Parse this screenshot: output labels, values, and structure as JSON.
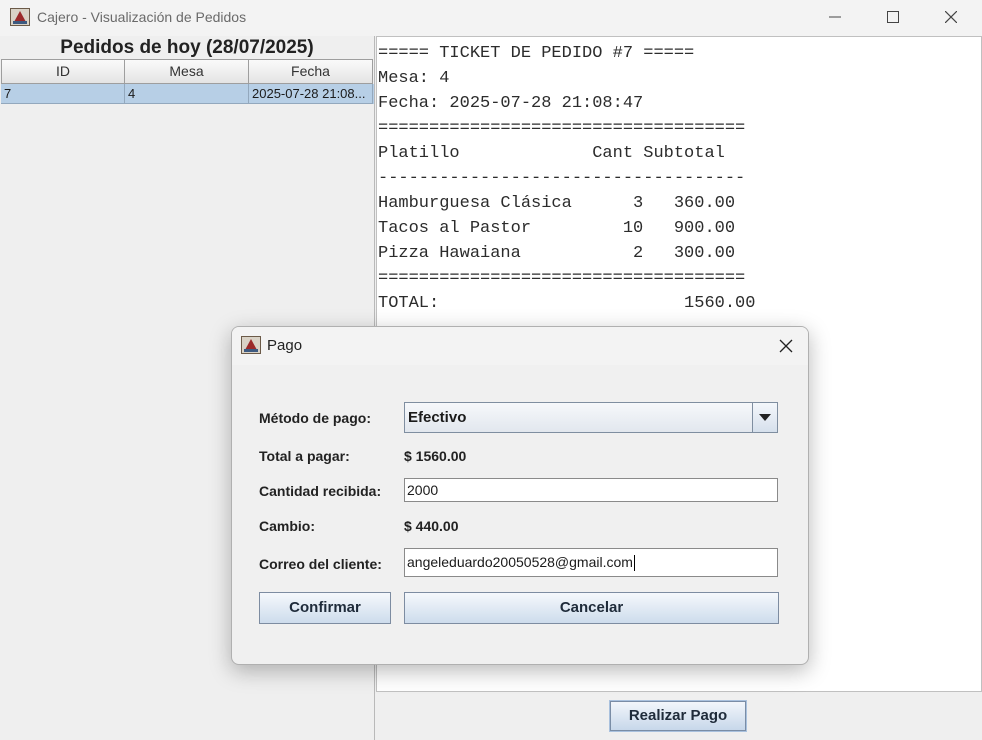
{
  "window": {
    "title": "Cajero - Visualización de Pedidos"
  },
  "orders": {
    "heading": "Pedidos de hoy (28/07/2025)",
    "columns": [
      "ID",
      "Mesa",
      "Fecha"
    ],
    "rows": [
      {
        "id": "7",
        "mesa": "4",
        "fecha": "2025-07-28 21:08..."
      }
    ]
  },
  "ticket": {
    "lines": [
      "===== TICKET DE PEDIDO #7 =====",
      "Mesa: 4",
      "Fecha: 2025-07-28 21:08:47",
      "====================================",
      "Platillo             Cant Subtotal",
      "------------------------------------",
      "Hamburguesa Clásica      3   360.00",
      "Tacos al Pastor         10   900.00",
      "Pizza Hawaiana           2   300.00",
      "====================================",
      "TOTAL:                        1560.00"
    ]
  },
  "footer": {
    "pay_button": "Realizar Pago"
  },
  "dialog": {
    "title": "Pago",
    "payment_method_label": "Método de pago:",
    "payment_method_value": "Efectivo",
    "total_label": "Total a pagar:",
    "total_value": "$ 1560.00",
    "received_label": "Cantidad recibida:",
    "received_value": "2000",
    "change_label": "Cambio:",
    "change_value": "$ 440.00",
    "email_label": "Correo del cliente:",
    "email_value": "angeleduardo20050528@gmail.com",
    "confirm_button": "Confirmar",
    "cancel_button": "Cancelar"
  },
  "icons": {
    "app": "java-app-icon",
    "minimize": "minimize-icon",
    "maximize": "maximize-icon",
    "close": "close-icon",
    "dropdown": "chevron-down-icon"
  },
  "colors": {
    "selected_row": "#b7cfe6",
    "button_gradient_top": "#f5f8fc",
    "button_gradient_bottom": "#cddcec"
  }
}
